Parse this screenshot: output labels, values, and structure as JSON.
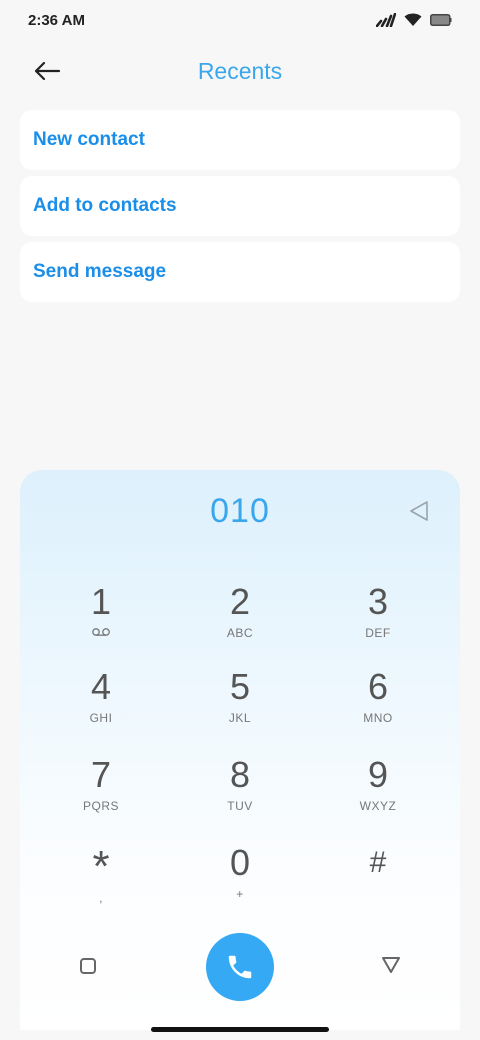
{
  "status": {
    "time": "2:36 AM"
  },
  "header": {
    "title": "Recents"
  },
  "actions": [
    {
      "label": "New contact"
    },
    {
      "label": "Add to contacts"
    },
    {
      "label": "Send message"
    }
  ],
  "dialer": {
    "number": "010",
    "keys": [
      {
        "digit": "1",
        "letters": ""
      },
      {
        "digit": "2",
        "letters": "ABC"
      },
      {
        "digit": "3",
        "letters": "DEF"
      },
      {
        "digit": "4",
        "letters": "GHI"
      },
      {
        "digit": "5",
        "letters": "JKL"
      },
      {
        "digit": "6",
        "letters": "MNO"
      },
      {
        "digit": "7",
        "letters": "PQRS"
      },
      {
        "digit": "8",
        "letters": "TUV"
      },
      {
        "digit": "9",
        "letters": "WXYZ"
      },
      {
        "digit": "*",
        "letters": ","
      },
      {
        "digit": "0",
        "letters": "+"
      },
      {
        "digit": "#",
        "letters": ""
      }
    ]
  },
  "colors": {
    "accent": "#3aa6ec",
    "call_button": "#36a9f4",
    "link": "#1a8ee8"
  }
}
